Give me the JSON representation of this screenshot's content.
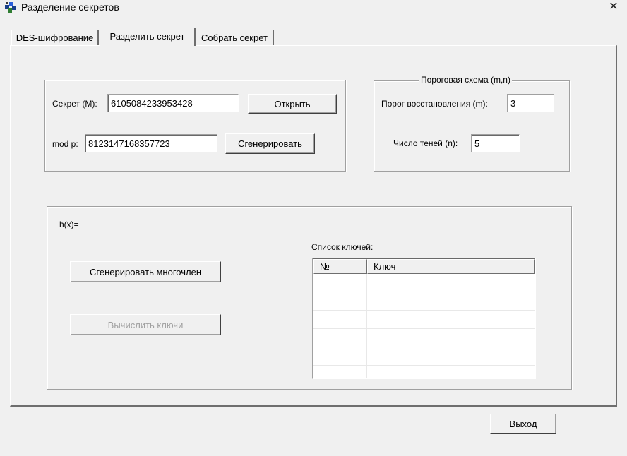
{
  "window": {
    "title": "Разделение секретов",
    "close_glyph": "✕",
    "icon": "app-icon"
  },
  "tabs": [
    {
      "label": "DES-шифрование",
      "active": false
    },
    {
      "label": "Разделить секрет",
      "active": true
    },
    {
      "label": "Собрать секрет",
      "active": false
    }
  ],
  "secret_group": {
    "secret_label": "Секрет (M):",
    "secret_value": "6105084233953428",
    "open_button": "Открыть",
    "modp_label": "mod p:",
    "modp_value": "8123147168357723",
    "generate_button": "Сгенерировать"
  },
  "threshold_group": {
    "legend": "Пороговая схема (m,n)",
    "m_label": "Порог восстановления (m):",
    "m_value": "3",
    "n_label": "Число теней (n):",
    "n_value": "5"
  },
  "poly_group": {
    "hx_label": "h(x)=",
    "gen_poly_button": "Сгенерировать многочлен",
    "calc_keys_button": "Вычислить ключи",
    "keys_list_label": "Список ключей:",
    "columns": [
      "№",
      "Ключ"
    ],
    "rows": []
  },
  "footer": {
    "exit_button": "Выход"
  }
}
